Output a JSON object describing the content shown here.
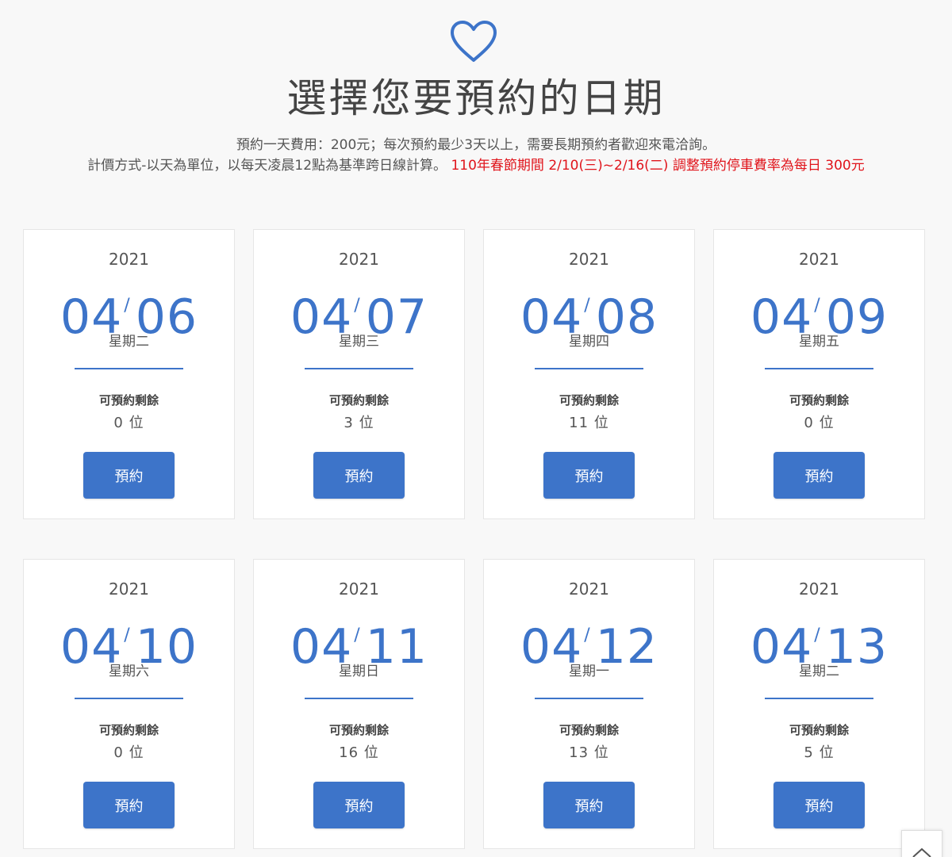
{
  "header": {
    "title": "選擇您要預約的日期",
    "info_line_1": "預約一天費用：200元；每次預約最少3天以上，需要長期預約者歡迎來電洽詢。",
    "info_line_2": "計價方式-以天為單位，以每天凌晨12點為基準跨日線計算。",
    "notice": "110年春節期間 2/10(三)~2/16(二) 調整預約停車費率為每日 300元",
    "heart_icon": "heart-icon",
    "notice_color": "#e0141b"
  },
  "accent_color": "#3d74c9",
  "cards": [
    {
      "year": "2021",
      "month": "04",
      "sep": "/",
      "day": "06",
      "weekday": "星期二",
      "remaining_label": "可預約剩餘",
      "remaining": "0 位",
      "button": "預約"
    },
    {
      "year": "2021",
      "month": "04",
      "sep": "/",
      "day": "07",
      "weekday": "星期三",
      "remaining_label": "可預約剩餘",
      "remaining": "3 位",
      "button": "預約"
    },
    {
      "year": "2021",
      "month": "04",
      "sep": "/",
      "day": "08",
      "weekday": "星期四",
      "remaining_label": "可預約剩餘",
      "remaining": "11 位",
      "button": "預約"
    },
    {
      "year": "2021",
      "month": "04",
      "sep": "/",
      "day": "09",
      "weekday": "星期五",
      "remaining_label": "可預約剩餘",
      "remaining": "0 位",
      "button": "預約"
    },
    {
      "year": "2021",
      "month": "04",
      "sep": "/",
      "day": "10",
      "weekday": "星期六",
      "remaining_label": "可預約剩餘",
      "remaining": "0 位",
      "button": "預約"
    },
    {
      "year": "2021",
      "month": "04",
      "sep": "/",
      "day": "11",
      "weekday": "星期日",
      "remaining_label": "可預約剩餘",
      "remaining": "16 位",
      "button": "預約"
    },
    {
      "year": "2021",
      "month": "04",
      "sep": "/",
      "day": "12",
      "weekday": "星期一",
      "remaining_label": "可預約剩餘",
      "remaining": "13 位",
      "button": "預約"
    },
    {
      "year": "2021",
      "month": "04",
      "sep": "/",
      "day": "13",
      "weekday": "星期二",
      "remaining_label": "可預約剩餘",
      "remaining": "5 位",
      "button": "預約"
    }
  ],
  "scroll_top": {
    "icon": "chevron-up-icon"
  }
}
